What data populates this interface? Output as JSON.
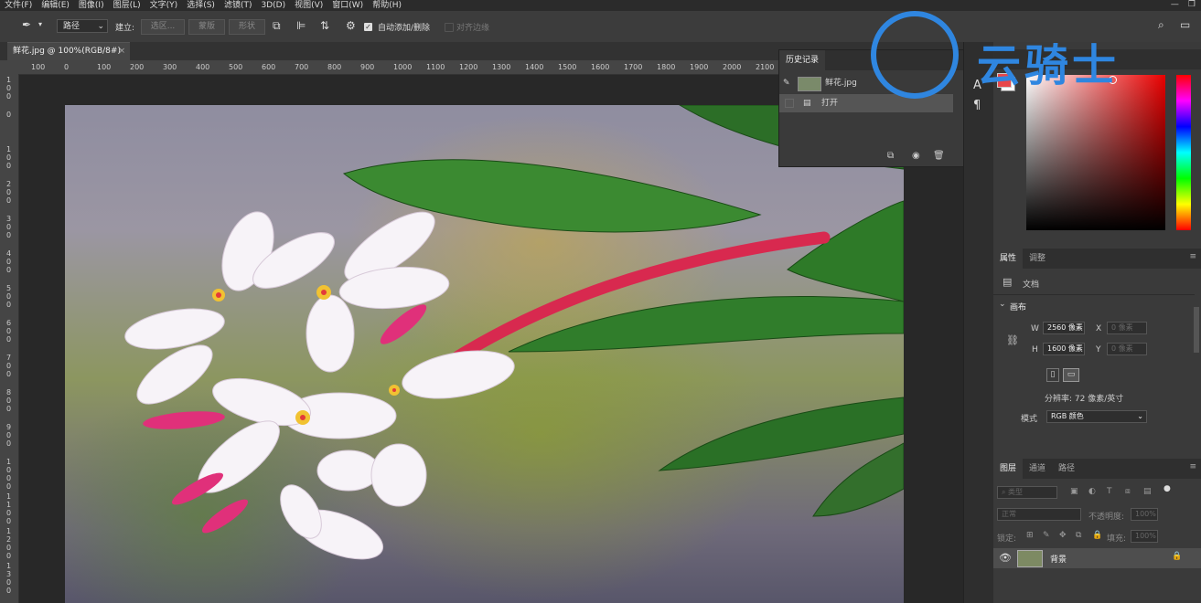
{
  "menu": [
    "文件(F)",
    "编辑(E)",
    "图像(I)",
    "图层(L)",
    "文字(Y)",
    "选择(S)",
    "滤镜(T)",
    "3D(D)",
    "视图(V)",
    "窗口(W)",
    "帮助(H)"
  ],
  "options": {
    "mode_select": "路径",
    "build_label": "建立:",
    "selection_btn": "选区...",
    "mask_btn": "蒙版",
    "shape_btn": "形状",
    "auto_add_delete": "自动添加/删除",
    "align_edges": "对齐边缘"
  },
  "document_tab": {
    "title": "鲜花.jpg @ 100%(RGB/8#)",
    "close": "×"
  },
  "ruler": {
    "h_ticks": [
      "100",
      "0",
      "100",
      "200",
      "300",
      "400",
      "500",
      "600",
      "700",
      "800",
      "900",
      "1000",
      "1100",
      "1200",
      "1300",
      "1400",
      "1500",
      "1600",
      "1700",
      "1800",
      "1900",
      "2000",
      "2100"
    ],
    "v_ticks": [
      "1 0 0",
      "0",
      "1 0 0",
      "2 0 0",
      "3 0 0",
      "4 0 0",
      "5 0 0",
      "6 0 0",
      "7 0 0",
      "8 0 0",
      "9 0 0",
      "1 0 0 0",
      "1 1 0 0",
      "1 2 0 0",
      "1 3 0 0"
    ]
  },
  "history": {
    "tab": "历史记录",
    "items": [
      {
        "label": "鲜花.jpg",
        "kind": "snapshot"
      },
      {
        "label": "打开",
        "kind": "step"
      }
    ]
  },
  "watermark": "云骑士",
  "color_panel": {
    "fg": "#e8474a",
    "bg": "#ffffff"
  },
  "properties": {
    "tabs": [
      "属性",
      "调整"
    ],
    "doc_label": "文档",
    "canvas_section": "画布",
    "w_label": "W",
    "w_value": "2560 像素",
    "h_label": "H",
    "h_value": "1600 像素",
    "x_label": "X",
    "x_value": "0 像素",
    "y_label": "Y",
    "y_value": "0 像素",
    "resolution": "分辨率: 72 像素/英寸",
    "mode_label": "模式",
    "mode_value": "RGB 颜色"
  },
  "layers": {
    "tabs": [
      "图层",
      "通道",
      "路径"
    ],
    "filter_kind": "类型",
    "blend_mode": "正常",
    "opacity_label": "不透明度:",
    "opacity_value": "100%",
    "lock_label": "锁定:",
    "fill_label": "填充:",
    "fill_value": "100%",
    "items": [
      {
        "name": "背景",
        "visible": true,
        "locked": true
      }
    ]
  }
}
